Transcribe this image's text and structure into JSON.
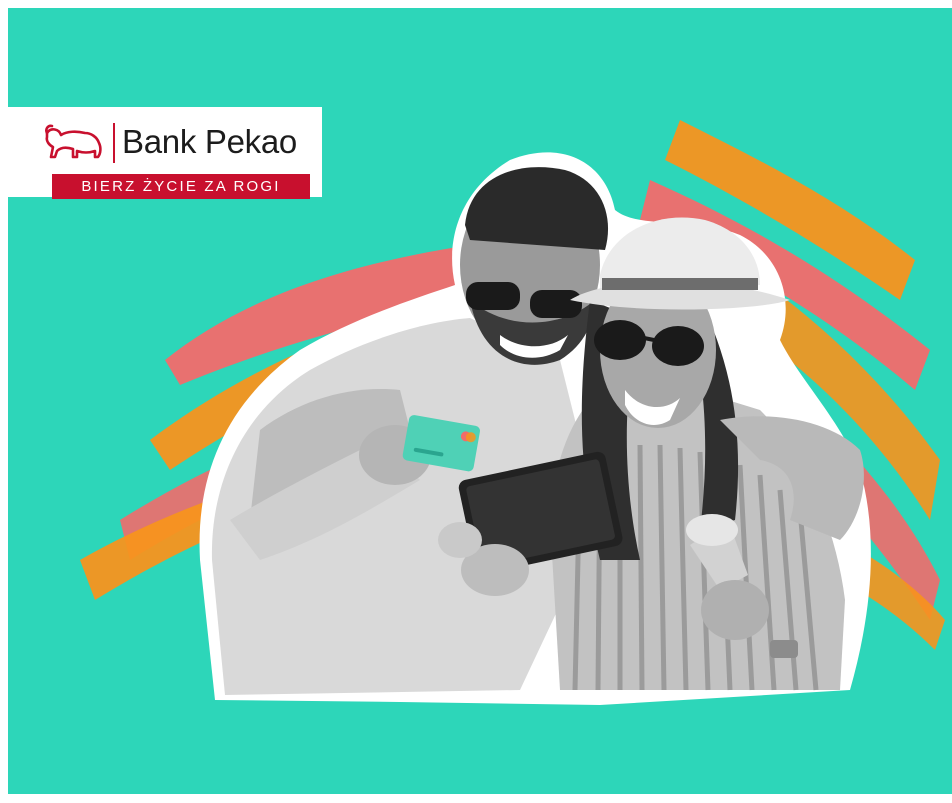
{
  "banner": {
    "brand_name": "Bank Pekao",
    "tagline": "BIERZ ŻYCIE ZA ROGI"
  },
  "icons": {
    "logo": "bison-icon"
  },
  "colors": {
    "background": "#2dd6b9",
    "brand_red": "#c8102e",
    "brush_coral": "#f26b6b",
    "brush_orange": "#f7941d"
  }
}
